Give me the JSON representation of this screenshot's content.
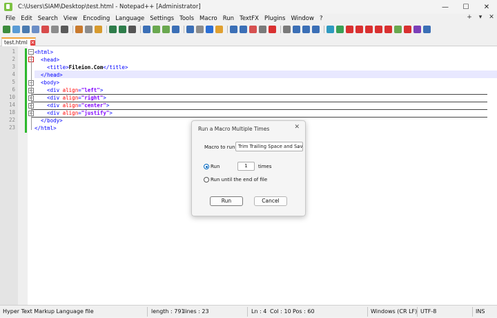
{
  "window": {
    "title": "C:\\Users\\SIAM\\Desktop\\test.html - Notepad++ [Administrator]",
    "controls": {
      "minimize": "—",
      "maximize": "☐",
      "close": "✕"
    }
  },
  "menu": {
    "items": [
      "File",
      "Edit",
      "Search",
      "View",
      "Encoding",
      "Language",
      "Settings",
      "Tools",
      "Macro",
      "Run",
      "TextFX",
      "Plugins",
      "Window",
      "?"
    ],
    "right": [
      "+",
      "▾",
      "✕"
    ]
  },
  "toolbar": {
    "colors": [
      "#3d8c3d",
      "#5a9bd5",
      "#4a7ab0",
      "#6b8ec6",
      "#d84b4b",
      "#8c8c8c",
      "#5a5a5a",
      "#c97a2e",
      "#8c8c8c",
      "#d89b2e",
      "#2e7d4a",
      "#2e7d4a",
      "#555555",
      "#3b6fb6",
      "#6aa84f",
      "#6aa84f",
      "#3b6fb6",
      "#3b6fb6",
      "#8c8c8c",
      "#2b6fd6",
      "#e0a030",
      "#3b6fb6",
      "#3b6fb6",
      "#d65050",
      "#7a7a7a",
      "#d93030",
      "#7a7a7a",
      "#3b6fb6",
      "#3b6fb6",
      "#3b6fb6",
      "#2e9ac0",
      "#3aa055",
      "#d93030",
      "#d93030",
      "#d93030",
      "#d93030",
      "#d93030",
      "#6aa84f",
      "#d93030",
      "#7b3fb8",
      "#3b6fb6"
    ]
  },
  "tab": {
    "label": "test.html",
    "close": "✕"
  },
  "editor": {
    "line_numbers": [
      "1",
      "2",
      "3",
      "4",
      "5",
      "6",
      "10",
      "14",
      "18",
      "22",
      "23"
    ],
    "lines": [
      [
        {
          "c": "tag",
          "t": "<html>"
        }
      ],
      [
        {
          "c": "tag",
          "t": "  <head>"
        }
      ],
      [
        {
          "c": "tag",
          "t": "    <title>"
        },
        {
          "c": "txt",
          "t": "Fileion.Com"
        },
        {
          "c": "tag",
          "t": "</title>"
        }
      ],
      [
        {
          "c": "tag",
          "t": "  </head>"
        }
      ],
      [
        {
          "c": "tag",
          "t": "  <body>"
        }
      ],
      [
        {
          "c": "tag",
          "t": "    <div "
        },
        {
          "c": "attr",
          "t": "align"
        },
        {
          "c": "tag",
          "t": "="
        },
        {
          "c": "str",
          "t": "\"left\""
        },
        {
          "c": "tag",
          "t": ">"
        }
      ],
      [
        {
          "c": "tag",
          "t": "    <div "
        },
        {
          "c": "attr",
          "t": "align"
        },
        {
          "c": "tag",
          "t": "="
        },
        {
          "c": "str",
          "t": "\"right\""
        },
        {
          "c": "tag",
          "t": ">"
        }
      ],
      [
        {
          "c": "tag",
          "t": "    <div "
        },
        {
          "c": "attr",
          "t": "align"
        },
        {
          "c": "tag",
          "t": "="
        },
        {
          "c": "str",
          "t": "\"center\""
        },
        {
          "c": "tag",
          "t": ">"
        }
      ],
      [
        {
          "c": "tag",
          "t": "    <div "
        },
        {
          "c": "attr",
          "t": "align"
        },
        {
          "c": "tag",
          "t": "="
        },
        {
          "c": "str",
          "t": "\"justify\""
        },
        {
          "c": "tag",
          "t": ">"
        }
      ],
      [
        {
          "c": "tag",
          "t": "  </body>"
        }
      ],
      [
        {
          "c": "tag",
          "t": "</html>"
        }
      ]
    ]
  },
  "dialog": {
    "title": "Run a Macro Multiple Times",
    "close": "✕",
    "macro_label": "Macro to run :",
    "macro_value": "Trim Trailing Space and Save",
    "run_label": "Run",
    "times_value": "1",
    "times_label": "times",
    "run_until_label": "Run until the end of file",
    "run_button": "Run",
    "cancel_button": "Cancel"
  },
  "status": {
    "file_type": "Hyper Text Markup Language file",
    "length": "length : 791",
    "lines": "lines : 23",
    "ln": "Ln : 4",
    "col": "Col : 10",
    "pos": "Pos : 60",
    "eol": "Windows (CR LF)",
    "encoding": "UTF-8",
    "mode": "INS"
  }
}
